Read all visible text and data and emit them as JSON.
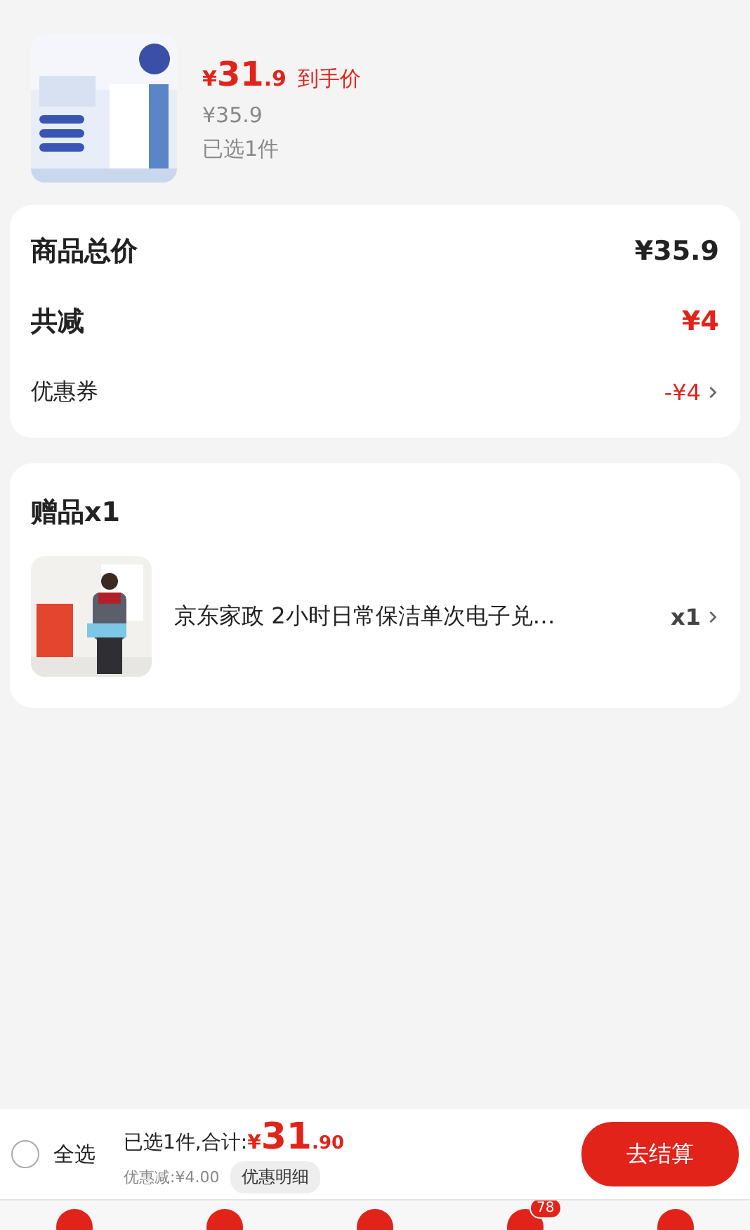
{
  "product": {
    "kind": "picture",
    "price": {
      "currency": "¥",
      "integer": "31",
      "decimal": ".9"
    },
    "price_label": "到手价",
    "original_price": "¥35.9",
    "selected_count": "已选1件"
  },
  "summary": {
    "rows": [
      {
        "label": "商品总价",
        "value": "¥35.9",
        "kind": "total"
      },
      {
        "label": "共减",
        "value": "¥4",
        "kind": "discount"
      },
      {
        "label": "优惠券",
        "value": "-¥4",
        "kind": "coupon"
      }
    ]
  },
  "gifts": {
    "title": "赠品x1",
    "items": [
      {
        "kind": "picture",
        "name": "京东家政 2小时日常保洁单次电子兑…",
        "quantity": "x1"
      }
    ]
  },
  "bottom_bar": {
    "select_all": {
      "label": "全选",
      "checked": false
    },
    "summary": "已选1件,合计:",
    "total": {
      "currency": "¥",
      "integer": "31",
      "decimal": ".90"
    },
    "discount": "优惠减:¥4.00",
    "detail_button": "优惠明细",
    "checkout_button": "去结算"
  },
  "nav": {
    "cart_badge": "78"
  }
}
